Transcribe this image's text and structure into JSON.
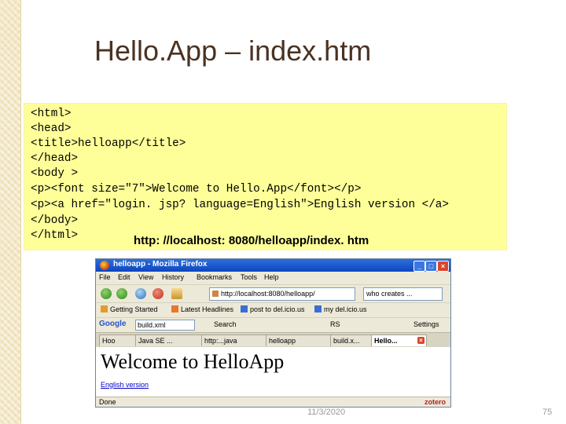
{
  "slide": {
    "title": "Hello.App – index.htm",
    "code_lines": [
      "<html>",
      "<head>",
      "<title>helloapp</title>",
      "</head>",
      "<body >",
      "<p><font size=\"7\">Welcome to Hello.App</font></p>",
      "<p><a href=\"login. jsp? language=English\">English version </a>",
      "</body>",
      "</html>"
    ],
    "url_caption": "http: //localhost: 8080/helloapp/index. htm",
    "footer_date": "11/3/2020",
    "page_number": "75"
  },
  "browser": {
    "window_title": "helloapp - Mozilla Firefox",
    "window_buttons": [
      "_",
      "□",
      "×"
    ],
    "menu": [
      "File",
      "Edit",
      "View",
      "History",
      "Bookmarks",
      "Tools",
      "Help"
    ],
    "address": "http://localhost:8080/helloapp/",
    "search_value": "who creates ...",
    "bookmarks": [
      "Getting Started",
      "Latest Headlines",
      "post to del.icio.us",
      "my del.icio.us"
    ],
    "google_bar": {
      "logo": "Google",
      "field_value": "build.xml",
      "search_label": "Search",
      "rs_label": "RS",
      "settings_label": "Settings"
    },
    "tabs": [
      "Hoo",
      "Java SE ...",
      "http:...java",
      "helloapp",
      "build.x...",
      "Hello..."
    ],
    "content": {
      "welcome": "Welcome to HelloApp",
      "link": "English version"
    },
    "status": "Done",
    "zotero": "zotero"
  },
  "colors": {
    "title_color": "#4a3222",
    "code_bg": "#ffff99",
    "xp_blue": "#0c45c2"
  }
}
